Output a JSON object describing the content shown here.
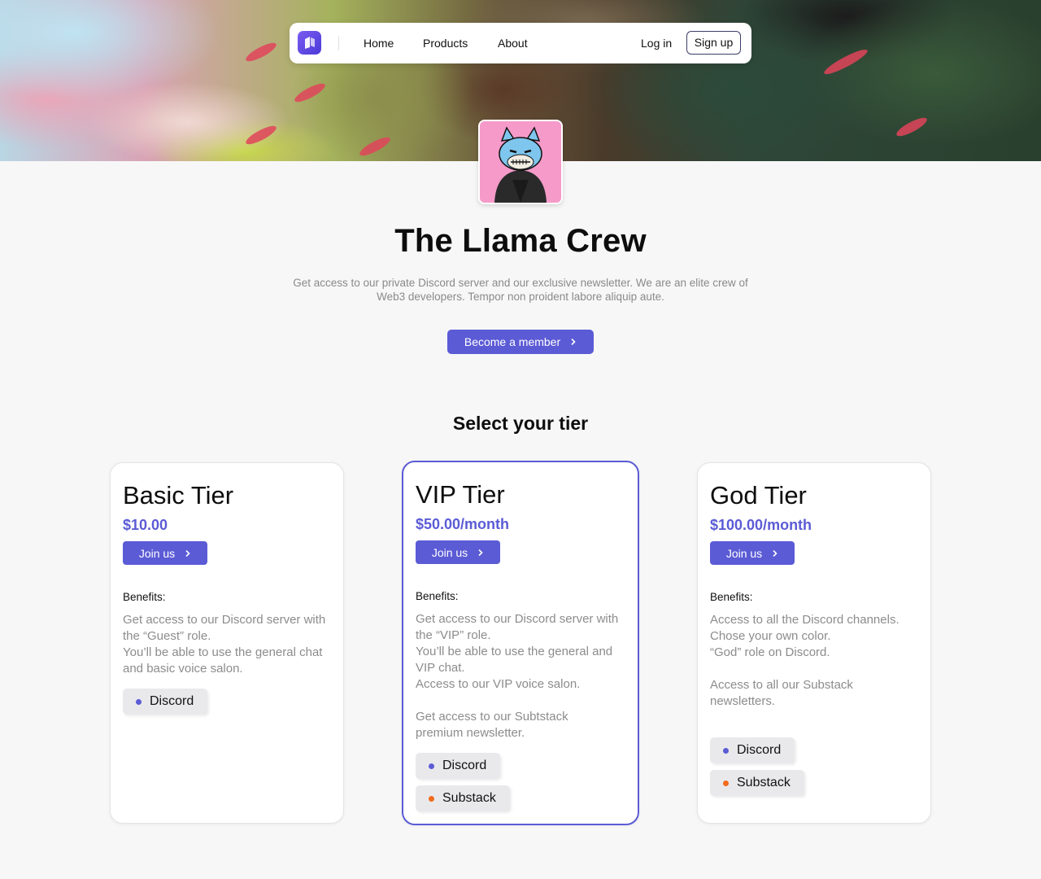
{
  "colors": {
    "accent": "#5b5bd6",
    "discord_dot": "#5b5bd6",
    "substack_dot": "#f26a1b"
  },
  "nav": {
    "logo_icon": "brand-logo-icon",
    "links": [
      "Home",
      "Products",
      "About"
    ],
    "login_label": "Log in",
    "signup_label": "Sign up"
  },
  "profile": {
    "avatar_icon": "llama-cat-avatar",
    "title": "The Llama Crew",
    "description": "Get access to our private Discord server and our exclusive newsletter. We are an elite crew of Web3 developers. Tempor non proident labore aliquip aute.",
    "cta_label": "Become a member"
  },
  "tiers_section": {
    "heading": "Select your tier",
    "tiers": [
      {
        "name": "Basic Tier",
        "price": "$10.00",
        "join_label": "Join us",
        "benefits_label": "Benefits:",
        "benefits": [
          [
            "Get access to our Discord server with the “Guest” role.",
            "You’ll be able to use the general chat and basic voice salon."
          ]
        ],
        "tags": [
          {
            "label": "Discord",
            "dot": "discord"
          }
        ],
        "featured": false
      },
      {
        "name": "VIP Tier",
        "price": "$50.00/month",
        "join_label": "Join us",
        "benefits_label": "Benefits:",
        "benefits": [
          [
            "Get access to our Discord server with the “VIP” role.",
            "You’ll be able to use the general and VIP chat.",
            "Access to our VIP voice salon."
          ],
          [
            "Get access to our Subtstack premium newsletter."
          ]
        ],
        "tags": [
          {
            "label": "Discord",
            "dot": "discord"
          },
          {
            "label": "Substack",
            "dot": "substack"
          }
        ],
        "featured": true
      },
      {
        "name": "God Tier",
        "price": "$100.00/month",
        "join_label": "Join us",
        "benefits_label": "Benefits:",
        "benefits": [
          [
            "Access to all the Discord channels.",
            "Chose your own color.",
            "“God” role on Discord."
          ],
          [
            "Access to all our Substack newsletters."
          ]
        ],
        "tags": [
          {
            "label": "Discord",
            "dot": "discord"
          },
          {
            "label": "Substack",
            "dot": "substack"
          }
        ],
        "featured": false
      }
    ]
  }
}
